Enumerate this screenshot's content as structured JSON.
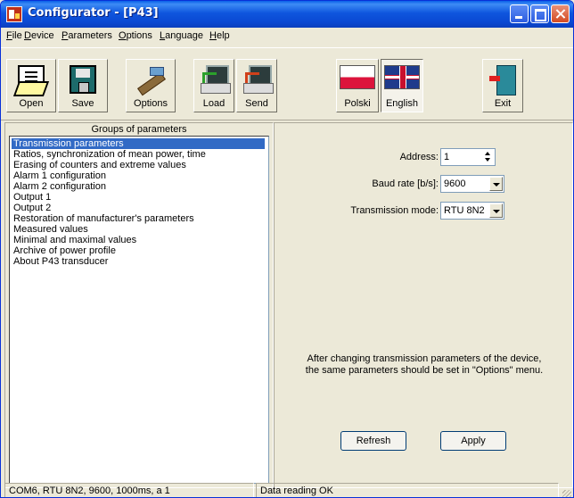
{
  "window": {
    "title": "Configurator - [P43]"
  },
  "menu": [
    "File",
    "Device",
    "Parameters",
    "Options",
    "Language",
    "Help"
  ],
  "toolbar": {
    "open": "Open",
    "save": "Save",
    "options": "Options",
    "load": "Load",
    "send": "Send",
    "polski": "Polski",
    "english": "English",
    "exit": "Exit"
  },
  "groups": {
    "title": "Groups of parameters",
    "items": [
      "Transmission parameters",
      "Ratios, synchronization of mean power, time",
      "Erasing of counters and extreme values",
      "Alarm 1 configuration",
      "Alarm 2 configuration",
      "Output 1",
      "Output 2",
      "Restoration of manufacturer's parameters",
      "Measured values",
      "Minimal and maximal values",
      "Archive of power profile",
      "About P43 transducer"
    ],
    "selected_index": 0
  },
  "form": {
    "address_label": "Address:",
    "address_value": "1",
    "baud_label": "Baud rate [b/s]:",
    "baud_value": "9600",
    "mode_label": "Transmission mode:",
    "mode_value": "RTU 8N2",
    "note_line1": "After changing transmission parameters of the device,",
    "note_line2": "the same parameters should be set in \"Options\" menu.",
    "refresh": "Refresh",
    "apply": "Apply"
  },
  "status": {
    "connection": "COM6, RTU 8N2, 9600, 1000ms, a 1",
    "message": "Data reading OK"
  }
}
